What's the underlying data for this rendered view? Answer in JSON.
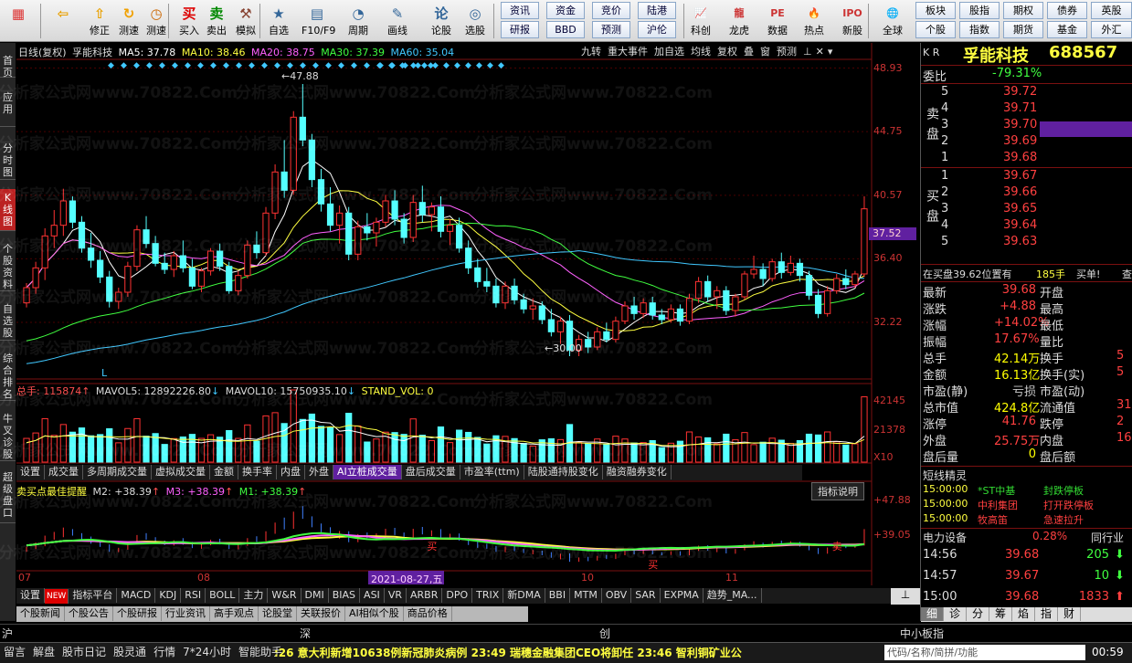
{
  "toolbar": {
    "main": [
      {
        "icon": "logo-icon",
        "label": ""
      },
      {
        "icon": "back-arrow-icon",
        "label": ""
      },
      {
        "icon": "up-arrow-icon",
        "label": "修正"
      },
      {
        "icon": "refresh-icon",
        "label": "测速"
      },
      {
        "icon": "clock-icon",
        "label": "测速"
      },
      {
        "icon": "buy-icon",
        "glyph": "买",
        "label": "买入"
      },
      {
        "icon": "sell-icon",
        "glyph": "卖",
        "label": "卖出"
      },
      {
        "icon": "hammer-icon",
        "label": "模拟"
      },
      {
        "icon": "star-icon",
        "label": "自选"
      },
      {
        "icon": "f10-icon",
        "label": "F10/F9"
      },
      {
        "icon": "period-icon",
        "label": "周期"
      },
      {
        "icon": "pencil-icon",
        "label": "画线"
      },
      {
        "icon": "lunzheng-icon",
        "glyph": "论",
        "label": "论股"
      },
      {
        "icon": "select-stock-icon",
        "label": "选股"
      }
    ],
    "small_row1": [
      "资讯",
      "资金",
      "竞价",
      "陆港"
    ],
    "small_row2": [
      "研报",
      "BBD",
      "预测",
      "沪伦"
    ],
    "extra": [
      {
        "icon": "kline-icon",
        "label": "科创"
      },
      {
        "icon": "dragon-icon",
        "label": "龙虎"
      },
      {
        "icon": "data-icon",
        "label": "数据"
      },
      {
        "icon": "hot-icon",
        "label": "热点"
      },
      {
        "icon": "new-stock-icon",
        "label": "新股"
      },
      {
        "icon": "globe-icon",
        "label": "全球"
      }
    ],
    "right_row1": [
      "板块",
      "股指",
      "期权",
      "债券",
      "英股"
    ],
    "right_row2": [
      "个股",
      "指数",
      "期货",
      "基金",
      "外汇"
    ]
  },
  "leftnav": [
    "首页",
    "应用",
    "分时图",
    "K线图",
    "个股资料",
    "自选股",
    "综合排名",
    "牛叉诊股",
    "超级盘口"
  ],
  "kline_header": {
    "period": "日线(复权)",
    "name": "孚能科技",
    "ma5": "MA5: 37.78",
    "ma10": "MA10: 38.46",
    "ma20": "MA20: 38.75",
    "ma30": "MA30: 37.39",
    "ma60": "MA60: 35.04",
    "menu": [
      "九转",
      "重大事件",
      "加自选",
      "均线",
      "复权",
      "叠",
      "窗",
      "预测"
    ]
  },
  "price_axis": [
    "48.93",
    "44.75",
    "40.57",
    "36.40",
    "32.22"
  ],
  "current_price_tag": "37.52",
  "high_label": "47.88",
  "low_label": "30.00",
  "vol_header": {
    "total": "总手: 115874",
    "mavol5": "MAVOL5: 12892226.80",
    "mavol10": "MAVOL10: 15750935.10",
    "stand": "STAND_VOL: 0"
  },
  "vol_axis": [
    "42145",
    "21378",
    "X10"
  ],
  "vol_tabs": [
    "设置",
    "成交量",
    "多周期成交量",
    "虚拟成交量",
    "金额",
    "换手率",
    "内盘",
    "外盘",
    "AI立桩成交量",
    "盘后成交量",
    "市盈率(ttm)",
    "陆股通持股变化",
    "融资融券变化"
  ],
  "ind_header": {
    "name": "卖买点最佳提醒",
    "m2": "M2: +38.39",
    "m3": "M3: +38.39",
    "m1": "M1: +38.39",
    "explain": "指标说明"
  },
  "ind_axis": [
    "+47.88",
    "+39.05"
  ],
  "date_axis": [
    "07",
    "08",
    "2021-08-27,五",
    "10",
    "11"
  ],
  "ind_tabs": [
    "设置",
    "NEW",
    "指标平台",
    "MACD",
    "KDJ",
    "RSI",
    "BOLL",
    "主力",
    "W&R",
    "DMI",
    "BIAS",
    "ASI",
    "VR",
    "ARBR",
    "DPO",
    "TRIX",
    "新DMA",
    "BBI",
    "MTM",
    "OBV",
    "SAR",
    "EXPMA",
    "趋势_MA..."
  ],
  "news_tabs": [
    "个股新闻",
    "个股公告",
    "个股研报",
    "行业资讯",
    "高手观点",
    "论股堂",
    "关联报价",
    "AI相似个股",
    "商品价格"
  ],
  "watermark": "分析家公式网www.70822.Com",
  "quote": {
    "market": "K R",
    "name": "孚能科技",
    "code": "688567",
    "weibi_label": "委比",
    "weibi": "-79.31%",
    "sell": [
      {
        "n": "5",
        "p": "39.72"
      },
      {
        "n": "4",
        "p": "39.71"
      },
      {
        "n": "3",
        "p": "39.70"
      },
      {
        "n": "2",
        "p": "39.69"
      },
      {
        "n": "1",
        "p": "39.68"
      }
    ],
    "buy": [
      {
        "n": "1",
        "p": "39.67"
      },
      {
        "n": "2",
        "p": "39.66"
      },
      {
        "n": "3",
        "p": "39.65"
      },
      {
        "n": "4",
        "p": "39.64"
      },
      {
        "n": "5",
        "p": "39.63"
      }
    ],
    "sell_label": "卖盘",
    "buy_label": "买盘",
    "position": "在买盘39.62位置有",
    "position_vol": "185手",
    "buy_action": "买单!",
    "query": "查",
    "stats": [
      {
        "l1": "最新",
        "v1": "39.68",
        "c1": "#ff4040",
        "l2": "开盘",
        "v2": ""
      },
      {
        "l1": "涨跌",
        "v1": "+4.88",
        "c1": "#ff4040",
        "l2": "最高",
        "v2": ""
      },
      {
        "l1": "涨幅",
        "v1": "+14.02%",
        "c1": "#ff4040",
        "l2": "最低",
        "v2": ""
      },
      {
        "l1": "振幅",
        "v1": "17.67%",
        "c1": "#ff4040",
        "l2": "量比",
        "v2": ""
      },
      {
        "l1": "总手",
        "v1": "42.14万",
        "c1": "#ffff00",
        "l2": "换手",
        "v2": "5"
      },
      {
        "l1": "金额",
        "v1": "16.13亿",
        "c1": "#ffff00",
        "l2": "换手(实)",
        "v2": "5"
      },
      {
        "l1": "市盈(静)",
        "v1": "亏损",
        "c1": "#cccccc",
        "l2": "市盈(动)",
        "v2": ""
      },
      {
        "l1": "总市值",
        "v1": "424.8亿",
        "c1": "#ffff00",
        "l2": "流通值",
        "v2": "31"
      },
      {
        "l1": "涨停",
        "v1": "41.76",
        "c1": "#ff4040",
        "l2": "跌停",
        "v2": "2"
      },
      {
        "l1": "外盘",
        "v1": "25.75万",
        "c1": "#ff4040",
        "l2": "内盘",
        "v2": "16."
      },
      {
        "l1": "盘后量",
        "v1": "0",
        "c1": "#ffff00",
        "l2": "盘后额",
        "v2": ""
      }
    ],
    "short_title": "短线精灵",
    "short": [
      {
        "t": "15:00:00",
        "n": "*ST中基",
        "e": "封跌停板",
        "c": "#33dd33"
      },
      {
        "t": "15:00:00",
        "n": "中利集团",
        "e": "打开跌停板",
        "c": "#ff4040"
      },
      {
        "t": "15:00:00",
        "n": "牧高笛",
        "e": "急速拉升",
        "c": "#ff4040"
      }
    ],
    "sector": "电力设备",
    "sector_pct": "0.28%",
    "sector_link": "同行业",
    "ticks": [
      {
        "t": "14:56",
        "p": "39.68",
        "v": "205",
        "d": "down"
      },
      {
        "t": "14:57",
        "p": "39.67",
        "v": "10",
        "d": "down"
      },
      {
        "t": "15:00",
        "p": "39.68",
        "v": "1833",
        "d": "up"
      }
    ],
    "bottom_tabs": [
      "细",
      "诊",
      "分",
      "筹",
      "焰",
      "指",
      "财"
    ]
  },
  "market_bar": {
    "sh": "沪",
    "sz": "深",
    "cy": "创",
    "zxb": "中小板指"
  },
  "statusbar": [
    "留言",
    "解盘",
    "股市日记",
    "股灵通",
    "行情",
    "7*24小时",
    "智能助手"
  ],
  "ticker": ":26 意大利新增10638例新冠肺炎病例    23:49 瑞穗金融集团CEO将卸任    23:46 智利铜矿业公",
  "search_hint": "代码/名称/简拼/功能",
  "clock": "00:59",
  "chart_data": {
    "type": "candlestick",
    "title": "孚能科技",
    "ylim": [
      28.5,
      49.5
    ],
    "x_labels": [
      "07",
      "08",
      "2021-08-27,五",
      "10",
      "11"
    ],
    "candles": [
      [
        33.5,
        34.8,
        33.2,
        34.5
      ],
      [
        34.5,
        36.2,
        34.1,
        35.8
      ],
      [
        35.8,
        38.4,
        35.0,
        37.9
      ],
      [
        37.9,
        39.6,
        37.1,
        38.6
      ],
      [
        38.6,
        41.0,
        37.9,
        40.2
      ],
      [
        40.2,
        40.5,
        38.4,
        38.8
      ],
      [
        38.8,
        39.2,
        36.8,
        37.1
      ],
      [
        37.1,
        38.1,
        35.8,
        36.3
      ],
      [
        36.3,
        36.9,
        34.8,
        35.2
      ],
      [
        35.2,
        35.6,
        33.2,
        33.6
      ],
      [
        33.6,
        34.5,
        33.1,
        34.2
      ],
      [
        34.2,
        36.2,
        33.9,
        35.9
      ],
      [
        35.9,
        38.6,
        35.6,
        38.3
      ],
      [
        38.3,
        39.2,
        37.1,
        37.4
      ],
      [
        37.4,
        37.9,
        35.9,
        36.1
      ],
      [
        36.1,
        36.8,
        35.4,
        35.7
      ],
      [
        35.7,
        36.9,
        35.2,
        36.6
      ],
      [
        36.6,
        37.6,
        35.5,
        35.8
      ],
      [
        35.8,
        36.4,
        34.4,
        34.6
      ],
      [
        34.6,
        35.8,
        34.2,
        35.6
      ],
      [
        35.6,
        37.1,
        35.3,
        36.9
      ],
      [
        36.9,
        37.4,
        35.6,
        35.9
      ],
      [
        35.9,
        36.2,
        34.1,
        34.3
      ],
      [
        34.3,
        35.6,
        34.0,
        35.3
      ],
      [
        35.3,
        37.6,
        35.1,
        37.3
      ],
      [
        37.3,
        38.2,
        36.4,
        36.8
      ],
      [
        36.8,
        39.8,
        36.6,
        39.4
      ],
      [
        39.4,
        42.6,
        39.0,
        42.1
      ],
      [
        42.1,
        44.2,
        40.4,
        40.9
      ],
      [
        40.9,
        46.1,
        40.6,
        45.7
      ],
      [
        45.7,
        47.88,
        43.8,
        44.2
      ],
      [
        44.2,
        44.6,
        41.1,
        41.6
      ],
      [
        41.6,
        42.3,
        39.5,
        40.0
      ],
      [
        40.0,
        41.1,
        38.2,
        38.6
      ],
      [
        38.6,
        39.9,
        37.4,
        39.4
      ],
      [
        39.4,
        39.8,
        36.3,
        36.7
      ],
      [
        36.7,
        38.9,
        36.3,
        38.5
      ],
      [
        38.5,
        39.4,
        37.6,
        38.1
      ],
      [
        38.1,
        39.1,
        37.2,
        38.8
      ],
      [
        38.8,
        40.6,
        38.5,
        40.2
      ],
      [
        40.2,
        40.9,
        38.6,
        39.0
      ],
      [
        39.0,
        39.4,
        37.4,
        37.8
      ],
      [
        37.8,
        40.6,
        37.5,
        40.1
      ],
      [
        40.1,
        41.2,
        38.8,
        39.3
      ],
      [
        39.3,
        40.1,
        38.2,
        39.8
      ],
      [
        39.8,
        40.5,
        37.8,
        38.2
      ],
      [
        38.2,
        39.0,
        37.3,
        38.6
      ],
      [
        38.6,
        39.1,
        36.8,
        37.1
      ],
      [
        37.1,
        37.6,
        35.4,
        35.8
      ],
      [
        35.8,
        36.4,
        34.5,
        34.9
      ],
      [
        34.9,
        35.8,
        34.2,
        34.6
      ],
      [
        34.6,
        35.1,
        33.2,
        33.5
      ],
      [
        33.5,
        34.9,
        33.1,
        34.6
      ],
      [
        34.6,
        35.1,
        33.4,
        33.7
      ],
      [
        33.7,
        34.1,
        32.8,
        33.1
      ],
      [
        33.1,
        33.8,
        32.4,
        33.3
      ],
      [
        33.3,
        33.6,
        32.1,
        32.4
      ],
      [
        32.4,
        33.1,
        31.3,
        31.6
      ],
      [
        31.6,
        32.6,
        30.8,
        32.3
      ],
      [
        32.3,
        32.7,
        30.0,
        30.4
      ],
      [
        30.4,
        31.4,
        30.0,
        31.1
      ],
      [
        31.1,
        31.6,
        30.2,
        30.6
      ],
      [
        30.6,
        31.9,
        30.4,
        31.6
      ],
      [
        31.6,
        32.2,
        30.9,
        31.1
      ],
      [
        31.1,
        32.6,
        30.9,
        32.3
      ],
      [
        32.3,
        33.6,
        32.1,
        33.3
      ],
      [
        33.3,
        33.9,
        32.4,
        32.8
      ],
      [
        32.8,
        33.8,
        32.5,
        33.5
      ],
      [
        33.5,
        33.9,
        32.4,
        32.7
      ],
      [
        32.7,
        33.1,
        32.1,
        32.4
      ],
      [
        32.4,
        33.4,
        32.2,
        33.1
      ],
      [
        33.1,
        33.4,
        32.0,
        32.3
      ],
      [
        32.3,
        34.1,
        32.1,
        33.8
      ],
      [
        33.8,
        35.2,
        33.5,
        34.9
      ],
      [
        34.9,
        35.3,
        33.6,
        33.9
      ],
      [
        33.9,
        34.6,
        33.1,
        34.3
      ],
      [
        34.3,
        34.6,
        32.7,
        33.0
      ],
      [
        33.0,
        34.1,
        32.6,
        33.9
      ],
      [
        33.9,
        35.6,
        33.7,
        35.4
      ],
      [
        35.4,
        36.6,
        35.1,
        35.7
      ],
      [
        35.7,
        36.1,
        34.6,
        35.1
      ],
      [
        35.1,
        36.4,
        34.9,
        36.2
      ],
      [
        36.2,
        36.8,
        35.1,
        35.5
      ],
      [
        35.5,
        36.6,
        35.3,
        36.1
      ],
      [
        36.1,
        36.4,
        34.9,
        35.3
      ],
      [
        35.3,
        35.6,
        33.7,
        34.0
      ],
      [
        34.0,
        34.4,
        32.5,
        32.8
      ],
      [
        32.8,
        34.6,
        32.6,
        34.3
      ],
      [
        34.3,
        35.4,
        34.1,
        35.1
      ],
      [
        35.1,
        35.7,
        34.4,
        34.7
      ],
      [
        34.7,
        35.6,
        34.5,
        35.4
      ],
      [
        35.4,
        40.5,
        35.2,
        39.68
      ]
    ]
  }
}
